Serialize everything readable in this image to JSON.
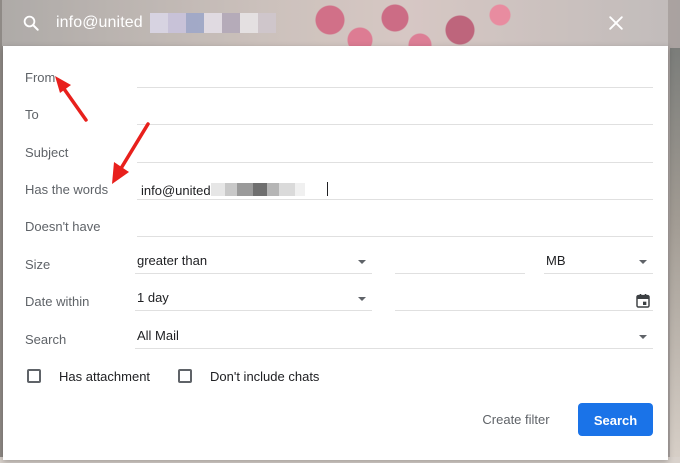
{
  "search_bar": {
    "query": "info@united",
    "close_label": "close"
  },
  "dialog": {
    "from_label": "From",
    "to_label": "To",
    "subject_label": "Subject",
    "has_words_label": "Has the words",
    "has_words_value": "info@united",
    "doesnt_have_label": "Doesn't have",
    "size_label": "Size",
    "size_operator": "greater than",
    "size_unit": "MB",
    "date_within_label": "Date within",
    "date_within_value": "1 day",
    "search_label": "Search",
    "search_scope": "All Mail",
    "has_attachment_label": "Has attachment",
    "dont_include_chats_label": "Don't include chats",
    "create_filter_label": "Create filter",
    "search_button_label": "Search"
  },
  "colors": {
    "accent": "#1a73e8",
    "annotation_arrow": "#e8201c",
    "label_gray": "#5f6368"
  },
  "icons": [
    "search-icon",
    "close-icon",
    "calendar-icon",
    "chevron-down-icon"
  ]
}
